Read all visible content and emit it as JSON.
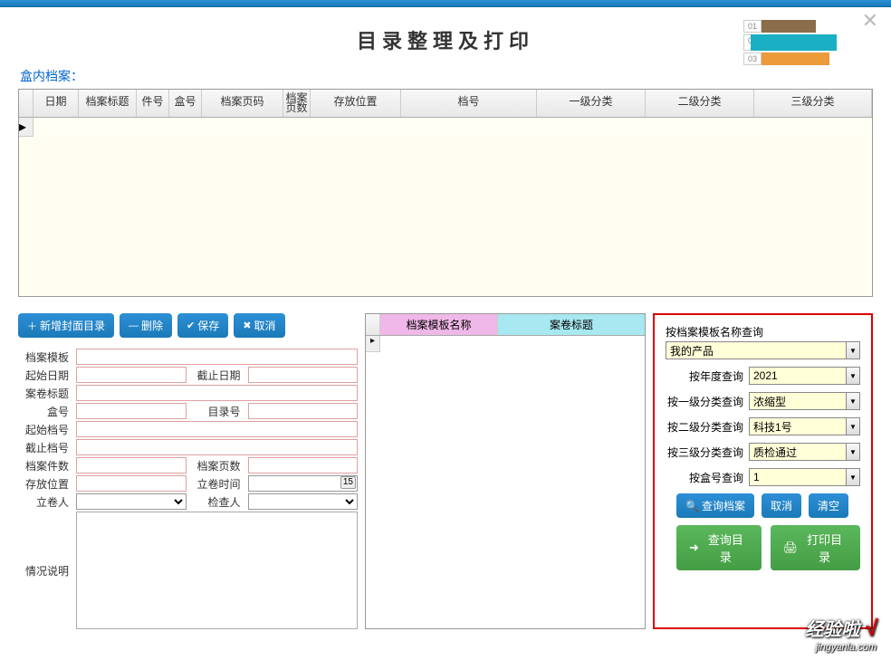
{
  "header": {
    "title": "目录整理及打印"
  },
  "section_label": "盒内档案：",
  "grid": {
    "columns": [
      "日期",
      "档案标题",
      "件号",
      "盒号",
      "档案页码",
      "档案页数",
      "存放位置",
      "档号",
      "一级分类",
      "二级分类",
      "三级分类"
    ]
  },
  "toolbar": {
    "add": "新增封面目录",
    "delete": "删除",
    "save": "保存",
    "cancel": "取消"
  },
  "form": {
    "labels": {
      "template": "档案模板",
      "start_date": "起始日期",
      "end_date": "截止日期",
      "title": "案卷标题",
      "box_no": "盒号",
      "catalog_no": "目录号",
      "start_file": "起始档号",
      "end_file": "截止档号",
      "file_count": "档案件数",
      "page_count": "档案页数",
      "location": "存放位置",
      "roll_time": "立卷时间",
      "roll_person": "立卷人",
      "check_person": "检查人",
      "remark": "情况说明"
    }
  },
  "mid_grid": {
    "col1": "档案模板名称",
    "col2": "案卷标题"
  },
  "query": {
    "label_template": "按档案模板名称查询",
    "template_value": "我的产品",
    "label_year": "按年度查询",
    "year_value": "2021",
    "label_l1": "按一级分类查询",
    "l1_value": "浓缩型",
    "label_l2": "按二级分类查询",
    "l2_value": "科技1号",
    "label_l3": "按三级分类查询",
    "l3_value": "质检通过",
    "label_box": "按盒号查询",
    "box_value": "1",
    "btn_search": "查询档案",
    "btn_cancel": "取消",
    "btn_clear": "清空",
    "btn_query_dir": "查询目录",
    "btn_print_dir": "打印目录"
  },
  "watermark": {
    "line1": "经验啦",
    "line2": "jingyanla.com"
  }
}
